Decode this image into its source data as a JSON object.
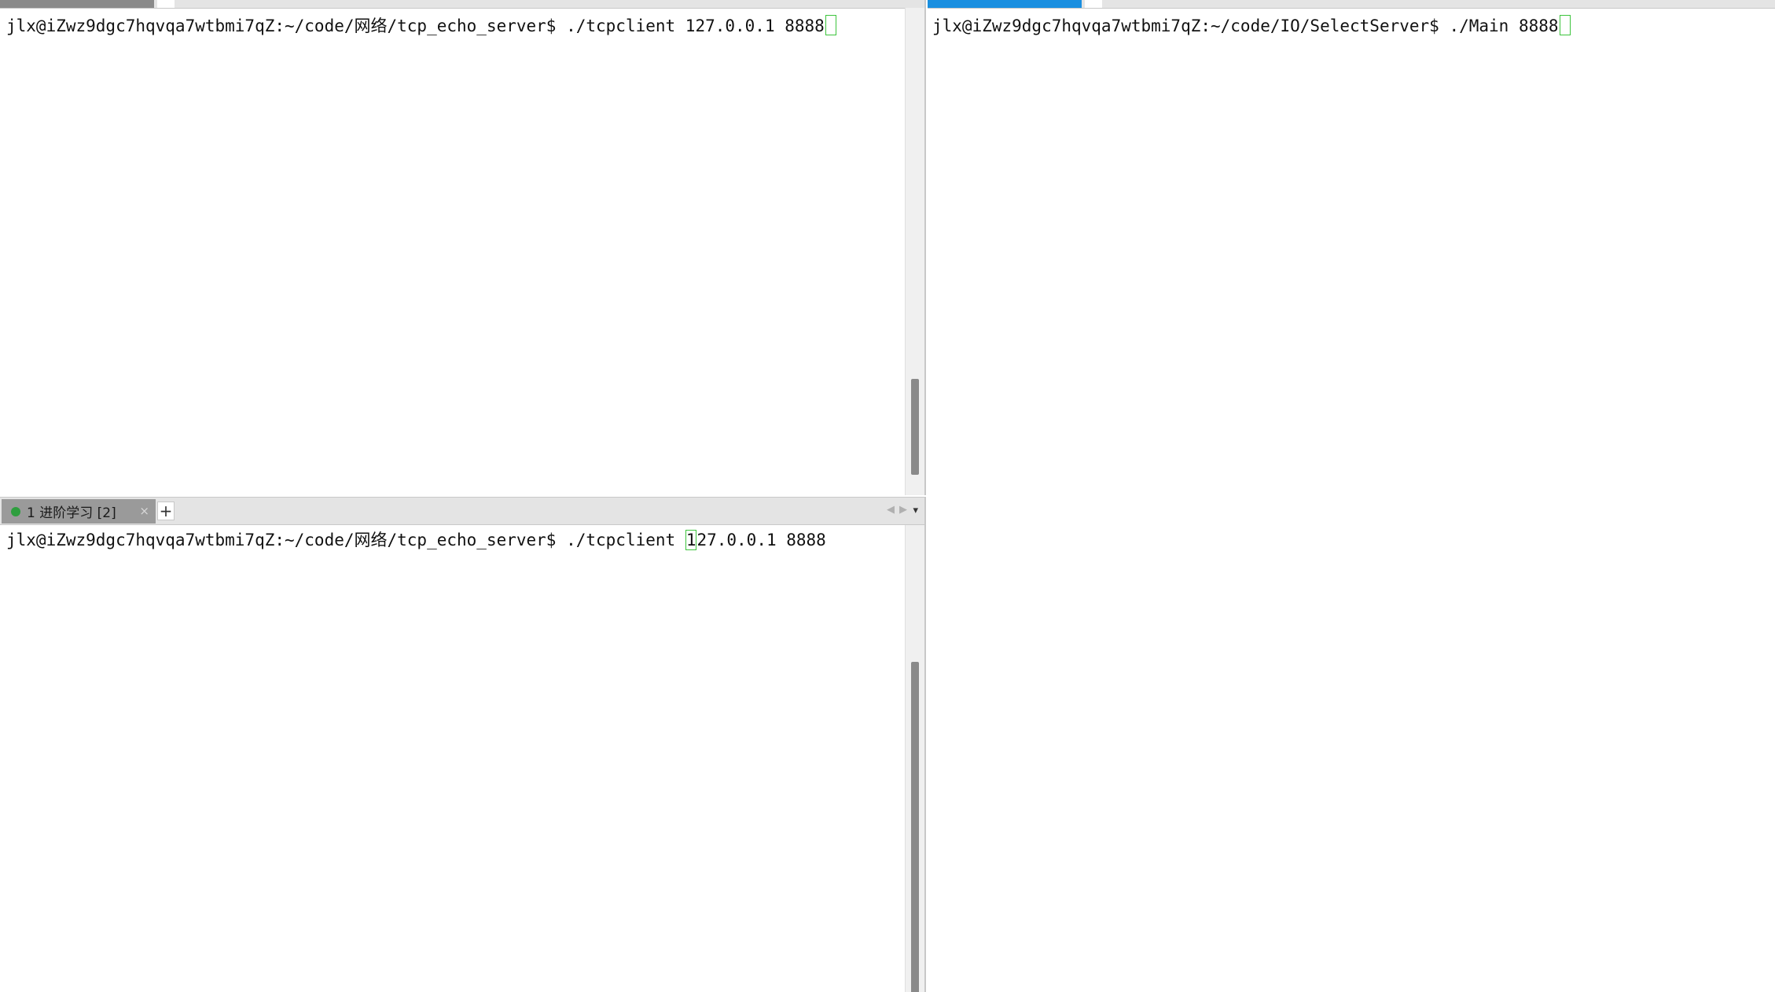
{
  "left_top_pane": {
    "prompt": "jlx@iZwz9dgc7hqvqa7wtbmi7qZ:~/code/网络/tcp_echo_server$ ",
    "command": "./tcpclient 127.0.0.1 8888"
  },
  "left_bottom_pane": {
    "tab": {
      "label": "1 进阶学习 [2]",
      "close": "×",
      "add": "+",
      "prev": "◀",
      "next": "▶",
      "menu": "▾"
    },
    "prompt": "jlx@iZwz9dgc7hqvqa7wtbmi7qZ:~/code/网络/tcp_echo_server$ ",
    "command_before_cursor": "./tcpclient ",
    "command_cursor_char": "1",
    "command_after_cursor": "27.0.0.1 8888"
  },
  "right_pane": {
    "prompt": "jlx@iZwz9dgc7hqvqa7wtbmi7qZ:~/code/IO/SelectServer$ ",
    "command": "./Main 8888"
  },
  "colors": {
    "cursor": "#3cc43c",
    "active_tab": "#1a8fe0",
    "session_dot": "#2e9e3e"
  }
}
